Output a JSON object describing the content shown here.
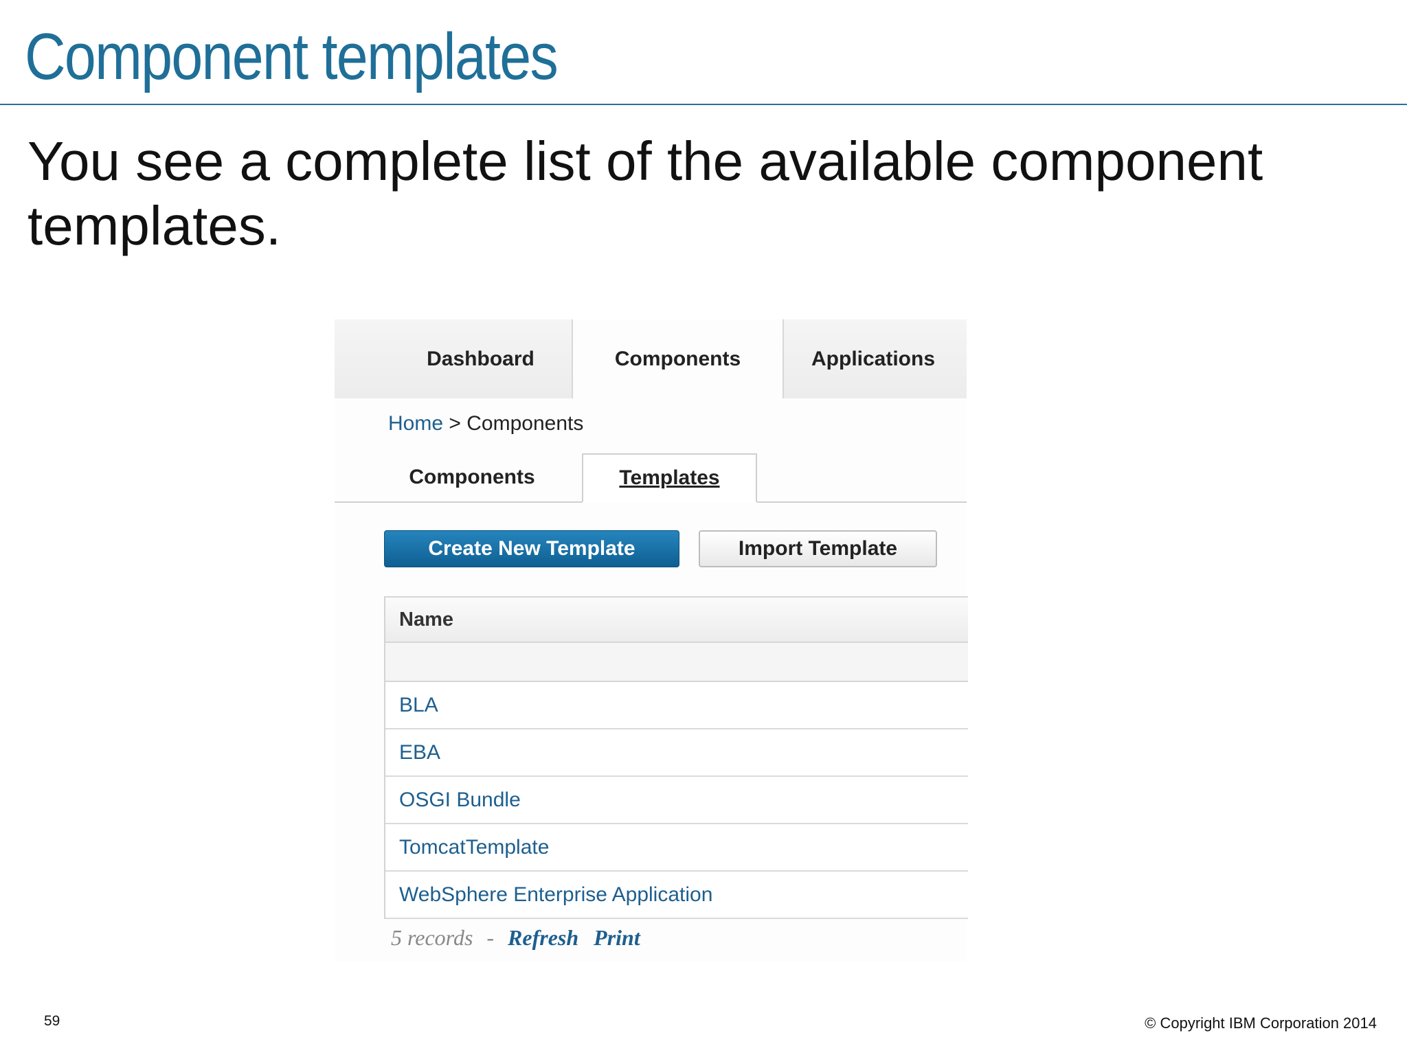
{
  "slide": {
    "title": "Component templates",
    "body": "You see a complete list of the available component templates.",
    "page_number": "59",
    "copyright": "© Copyright IBM Corporation 2014"
  },
  "app": {
    "top_tabs": [
      "Dashboard",
      "Components",
      "Applications"
    ],
    "breadcrumb": {
      "home": "Home",
      "separator": ">",
      "current": "Components"
    },
    "sub_tabs": [
      "Components",
      "Templates"
    ],
    "buttons": {
      "create": "Create New Template",
      "import": "Import Template"
    },
    "table": {
      "header": "Name",
      "rows": [
        "BLA",
        "EBA",
        "OSGI Bundle",
        "TomcatTemplate",
        "WebSphere Enterprise Application"
      ]
    },
    "footer": {
      "count": "5 records",
      "separator": "-",
      "refresh": "Refresh",
      "print": "Print"
    },
    "colors": {
      "accent": "#1d5f8f",
      "primary_button": "#1f76ad",
      "title": "#1f6f98"
    }
  }
}
